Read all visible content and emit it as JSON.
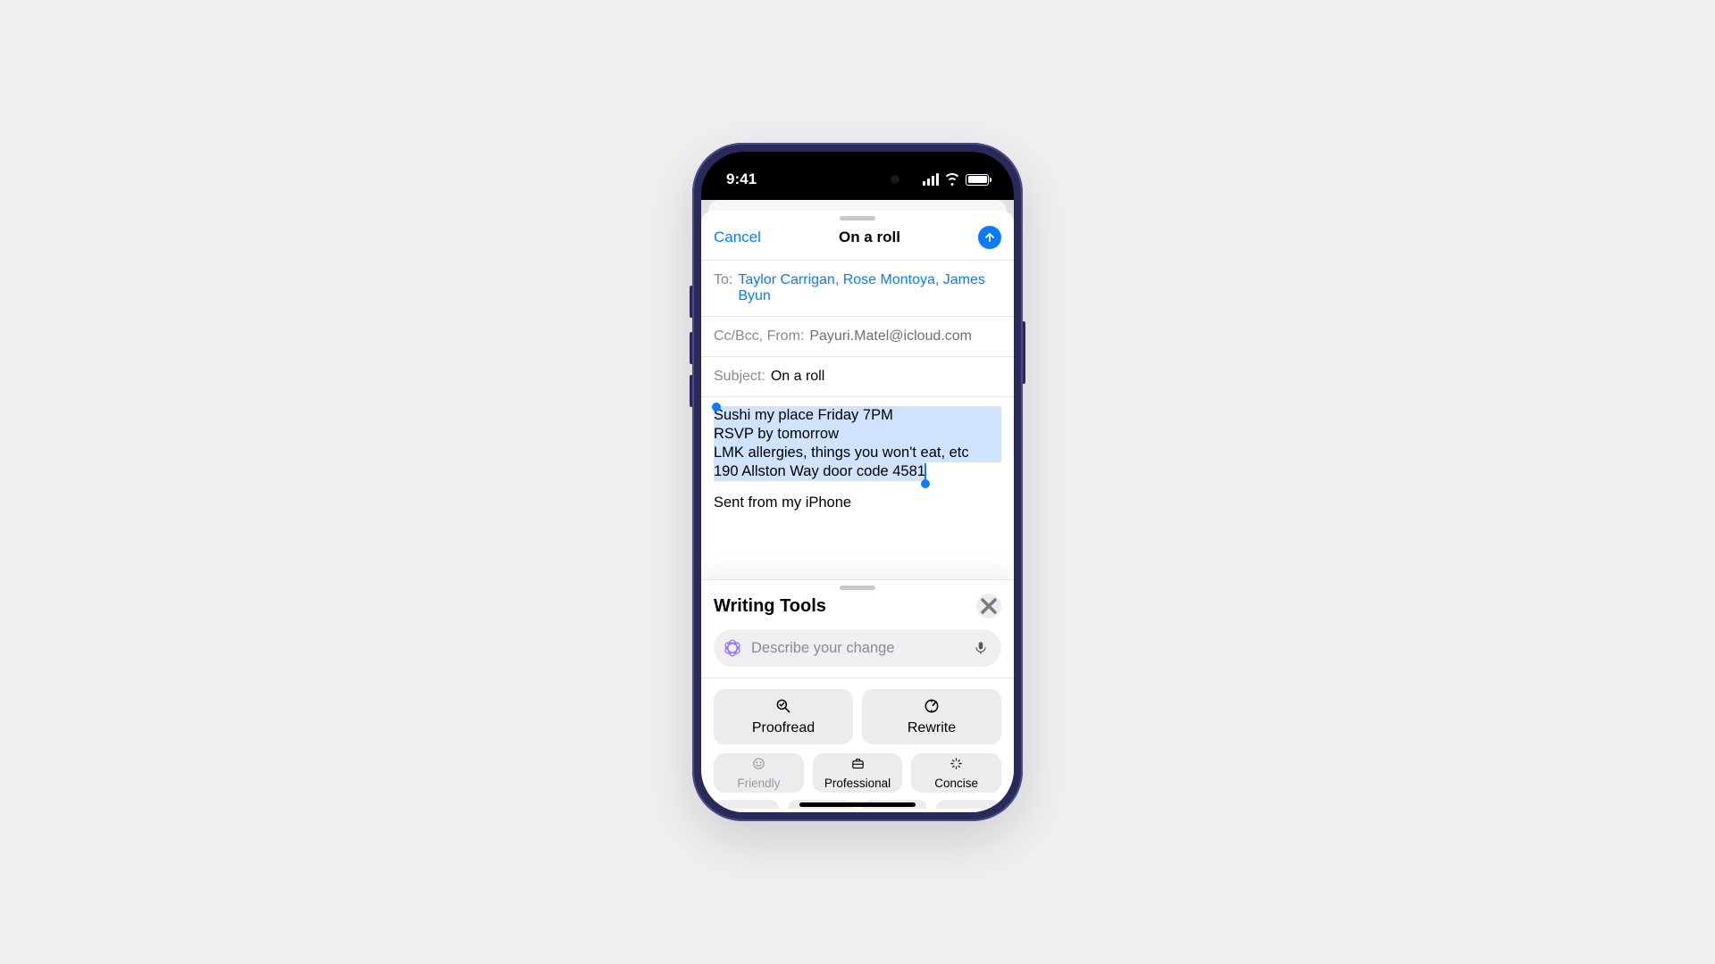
{
  "status": {
    "time": "9:41"
  },
  "compose": {
    "cancel": "Cancel",
    "title": "On a roll",
    "to_label": "To:",
    "recipients": "Taylor Carrigan, Rose Montoya, James Byun",
    "ccbcc_label": "Cc/Bcc, From:",
    "from_value": "Payuri.Matel@icloud.com",
    "subject_label": "Subject:",
    "subject_value": "On a roll",
    "body_lines": [
      "Sushi my place Friday 7PM",
      "RSVP by tomorrow",
      "LMK allergies, things you won't eat, etc",
      "190 Allston Way door code 4581"
    ],
    "signature": "Sent from my iPhone"
  },
  "tools": {
    "title": "Writing Tools",
    "describe_placeholder": "Describe your change",
    "proofread": "Proofread",
    "rewrite": "Rewrite",
    "friendly": "Friendly",
    "professional": "Professional",
    "concise": "Concise"
  }
}
